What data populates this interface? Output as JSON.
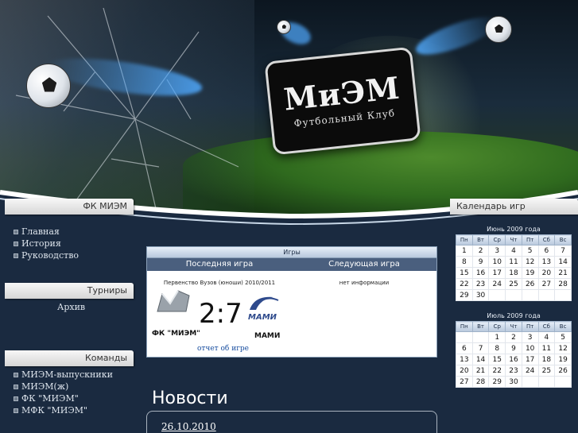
{
  "header": {
    "logo_title": "МиЭМ",
    "logo_subtitle": "Футбольный Клуб"
  },
  "sidebar": {
    "club_tab": "ФК МИЭМ",
    "nav_items": [
      "Главная",
      "История",
      "Руководство"
    ],
    "tournaments_tab": "Турниры",
    "archive_label": "Архив",
    "teams_tab": "Команды",
    "teams": [
      "МИЭМ-выпускники",
      "МИЭМ(ж)",
      "ФК \"МИЭМ\"",
      "МФК \"МИЭМ\""
    ]
  },
  "games": {
    "header": "Игры",
    "last_game_label": "Последняя игра",
    "next_game_label": "Следующая игра",
    "last_tournament": "Первенство Вузов (юноши) 2010/2011",
    "next_info": "нет информации",
    "score": "2:7",
    "home_team": "ФК \"МИЭМ\"",
    "away_team": "МАМИ",
    "away_logo_text": "МАМИ",
    "report_link": "отчет об игре"
  },
  "news": {
    "title": "Новости",
    "first_date": "26.10.2010"
  },
  "calendar": {
    "tab": "Календарь игр",
    "weekdays": [
      "Пн",
      "Вт",
      "Ср",
      "Чт",
      "Пт",
      "Сб",
      "Вс"
    ],
    "months": [
      {
        "title": "Июнь 2009 года",
        "weeks": [
          [
            "1",
            "2",
            "3",
            "4",
            "5",
            "6",
            "7"
          ],
          [
            "8",
            "9",
            "10",
            "11",
            "12",
            "13",
            "14"
          ],
          [
            "15",
            "16",
            "17",
            "18",
            "19",
            "20",
            "21"
          ],
          [
            "22",
            "23",
            "24",
            "25",
            "26",
            "27",
            "28"
          ],
          [
            "29",
            "30",
            "",
            "",
            "",
            "",
            ""
          ]
        ]
      },
      {
        "title": "Июль 2009 года",
        "weeks": [
          [
            "",
            "",
            "1",
            "2",
            "3",
            "4",
            "5"
          ],
          [
            "6",
            "7",
            "8",
            "9",
            "10",
            "11",
            "12"
          ],
          [
            "13",
            "14",
            "15",
            "16",
            "17",
            "18",
            "19"
          ],
          [
            "20",
            "21",
            "22",
            "23",
            "24",
            "25",
            "26"
          ],
          [
            "27",
            "28",
            "29",
            "30",
            "",
            "",
            ""
          ]
        ]
      }
    ]
  },
  "colors": {
    "page_bg": "#1a2a40",
    "tab_bg": "#e8e8e8",
    "table_header": "#4a5f7e",
    "link": "#1a4fa0"
  }
}
